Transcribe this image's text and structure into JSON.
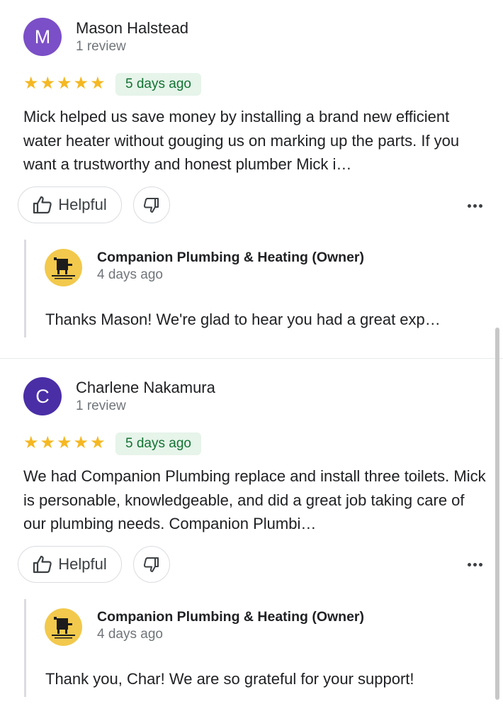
{
  "reviews": [
    {
      "avatar_letter": "M",
      "avatar_color": "#7b4fc7",
      "name": "Mason Halstead",
      "review_count": "1 review",
      "rating": 5,
      "date": "5 days ago",
      "text": "Mick helped us save money by installing a brand new efficient water heater without gouging us on marking up the parts. If you want a trustworthy and honest plumber Mick i…",
      "helpful_label": "Helpful",
      "reply": {
        "owner_name": "Companion Plumbing & Heating (Owner)",
        "date": "4 days ago",
        "text": "Thanks Mason! We're glad to hear you had a great exp…"
      }
    },
    {
      "avatar_letter": "C",
      "avatar_color": "#4a2ea6",
      "name": "Charlene Nakamura",
      "review_count": "1 review",
      "rating": 5,
      "date": "5 days ago",
      "text": "We had Companion Plumbing replace and install three toilets.  Mick is personable, knowledgeable, and did a great job taking care of our plumbing needs.  Companion Plumbi…",
      "helpful_label": "Helpful",
      "reply": {
        "owner_name": "Companion Plumbing & Heating (Owner)",
        "date": "4 days ago",
        "text": "Thank you, Char! We are so grateful for your support!"
      }
    }
  ],
  "icons": {
    "star": "star-icon",
    "thumbs_up": "thumbs-up-icon",
    "thumbs_down": "thumbs-down-icon",
    "more": "more-horizontal-icon"
  },
  "colors": {
    "star": "#f5b823",
    "date_badge_bg": "#e6f4ea",
    "date_badge_text": "#137333"
  }
}
